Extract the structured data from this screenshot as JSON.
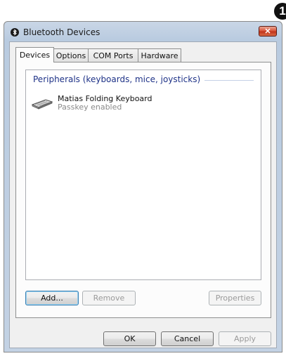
{
  "callout": {
    "number": "1"
  },
  "window": {
    "title": "Bluetooth Devices",
    "close_glyph": "✕"
  },
  "tabs": [
    {
      "label": "Devices",
      "active": true
    },
    {
      "label": "Options",
      "active": false
    },
    {
      "label": "COM Ports",
      "active": false
    },
    {
      "label": "Hardware",
      "active": false
    }
  ],
  "devices_panel": {
    "group_title": "Peripherals (keyboards, mice, joysticks)",
    "devices": [
      {
        "name": "Matias Folding Keyboard",
        "status": "Passkey enabled",
        "icon": "keyboard-icon"
      }
    ],
    "buttons": {
      "add": "Add...",
      "remove": "Remove",
      "properties": "Properties"
    }
  },
  "dialog_buttons": {
    "ok": "OK",
    "cancel": "Cancel",
    "apply": "Apply"
  },
  "colors": {
    "group_title": "#1e3287",
    "close_button": "#c1341c",
    "title_bar": "#b9cbe0"
  }
}
